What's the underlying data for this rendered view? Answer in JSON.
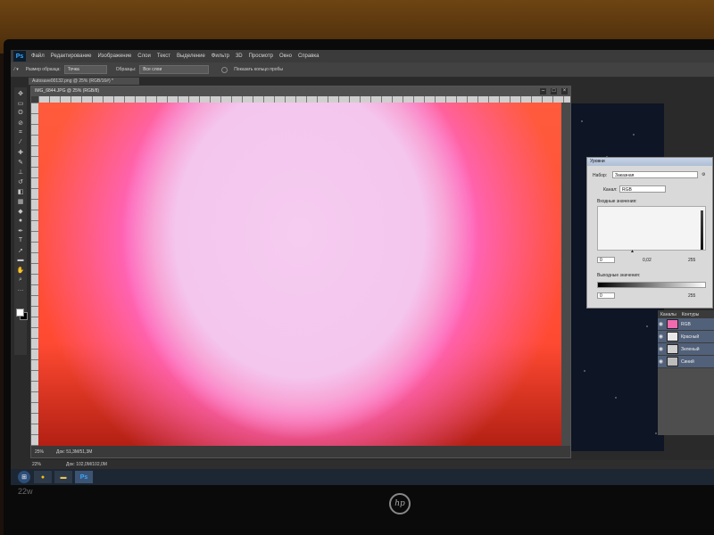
{
  "menu": {
    "logo": "Ps",
    "items": [
      "Файл",
      "Редактирование",
      "Изображение",
      "Слои",
      "Текст",
      "Выделение",
      "Фильтр",
      "3D",
      "Просмотр",
      "Окно",
      "Справка"
    ]
  },
  "options": {
    "sample_label": "Размер образца:",
    "sample_value": "Точка",
    "samples_label": "Образцы:",
    "samples_value": "Все слои",
    "show_ring": "Показать кольцо пробы"
  },
  "doc_tab": "Autosave00132.png @ 25% (RGB/16#) *",
  "document": {
    "title": "IMG_6844.JPG @ 25% (RGB/8)",
    "zoom": "25%",
    "status": "Док: 51,3M/51,3M"
  },
  "levels": {
    "title": "Уровни",
    "preset_label": "Набор:",
    "preset_value": "Заказная",
    "channel_label": "Канал:",
    "channel_value": "RGB",
    "input_label": "Входные значения:",
    "input_black": "0",
    "input_mid": "0,02",
    "input_white": "255",
    "output_label": "Выходные значения:",
    "output_black": "0",
    "output_white": "255"
  },
  "channels": {
    "tabs": [
      "Каналы",
      "Контуры"
    ],
    "rows": [
      {
        "name": "RGB",
        "color": "#f06ab0"
      },
      {
        "name": "Красный",
        "color": "#e8e8e8"
      },
      {
        "name": "Зеленый",
        "color": "#d0d0d0"
      },
      {
        "name": "Синий",
        "color": "#bcbcbc"
      }
    ]
  },
  "app_status": {
    "zoom": "22%",
    "doc": "Док: 102,0M/102,0M"
  },
  "bezel": {
    "model": "22w",
    "brand": "hp"
  }
}
